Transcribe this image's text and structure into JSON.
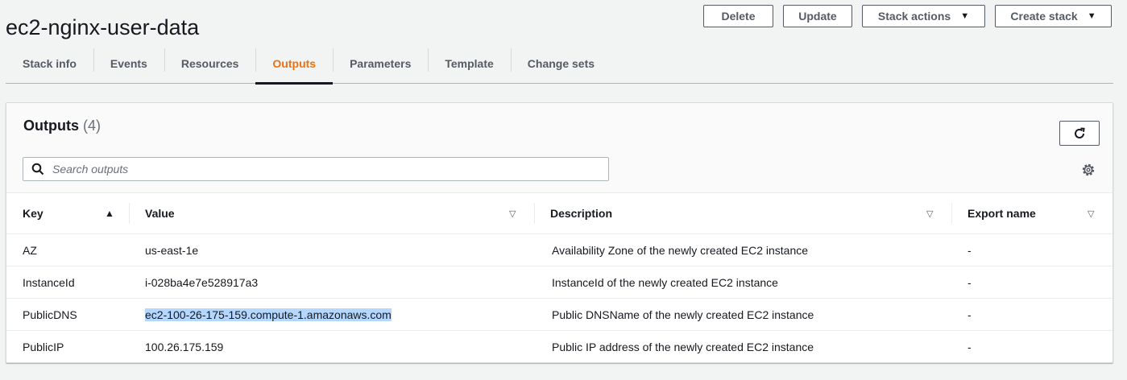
{
  "header": {
    "title": "ec2-nginx-user-data",
    "buttons": {
      "delete": "Delete",
      "update": "Update",
      "stack_actions": "Stack actions",
      "create_stack": "Create stack"
    }
  },
  "tabs": [
    {
      "label": "Stack info",
      "active": false
    },
    {
      "label": "Events",
      "active": false
    },
    {
      "label": "Resources",
      "active": false
    },
    {
      "label": "Outputs",
      "active": true
    },
    {
      "label": "Parameters",
      "active": false
    },
    {
      "label": "Template",
      "active": false
    },
    {
      "label": "Change sets",
      "active": false
    }
  ],
  "outputs": {
    "title": "Outputs",
    "count": "(4)",
    "search_placeholder": "Search outputs",
    "columns": [
      "Key",
      "Value",
      "Description",
      "Export name"
    ],
    "rows": [
      {
        "key": "AZ",
        "value": "us-east-1e",
        "description": "Availability Zone of the newly created EC2 instance",
        "export": "-"
      },
      {
        "key": "InstanceId",
        "value": "i-028ba4e7e528917a3",
        "description": "InstanceId of the newly created EC2 instance",
        "export": "-"
      },
      {
        "key": "PublicDNS",
        "value": "ec2-100-26-175-159.compute-1.amazonaws.com",
        "description": "Public DNSName of the newly created EC2 instance",
        "export": "-"
      },
      {
        "key": "PublicIP",
        "value": "100.26.175.159",
        "description": "Public IP address of the newly created EC2 instance",
        "export": "-"
      }
    ]
  },
  "colors": {
    "accent": "#ec7211",
    "text": "#16191f",
    "selection": "#b3d7ff",
    "background": "#f2f3f3"
  }
}
